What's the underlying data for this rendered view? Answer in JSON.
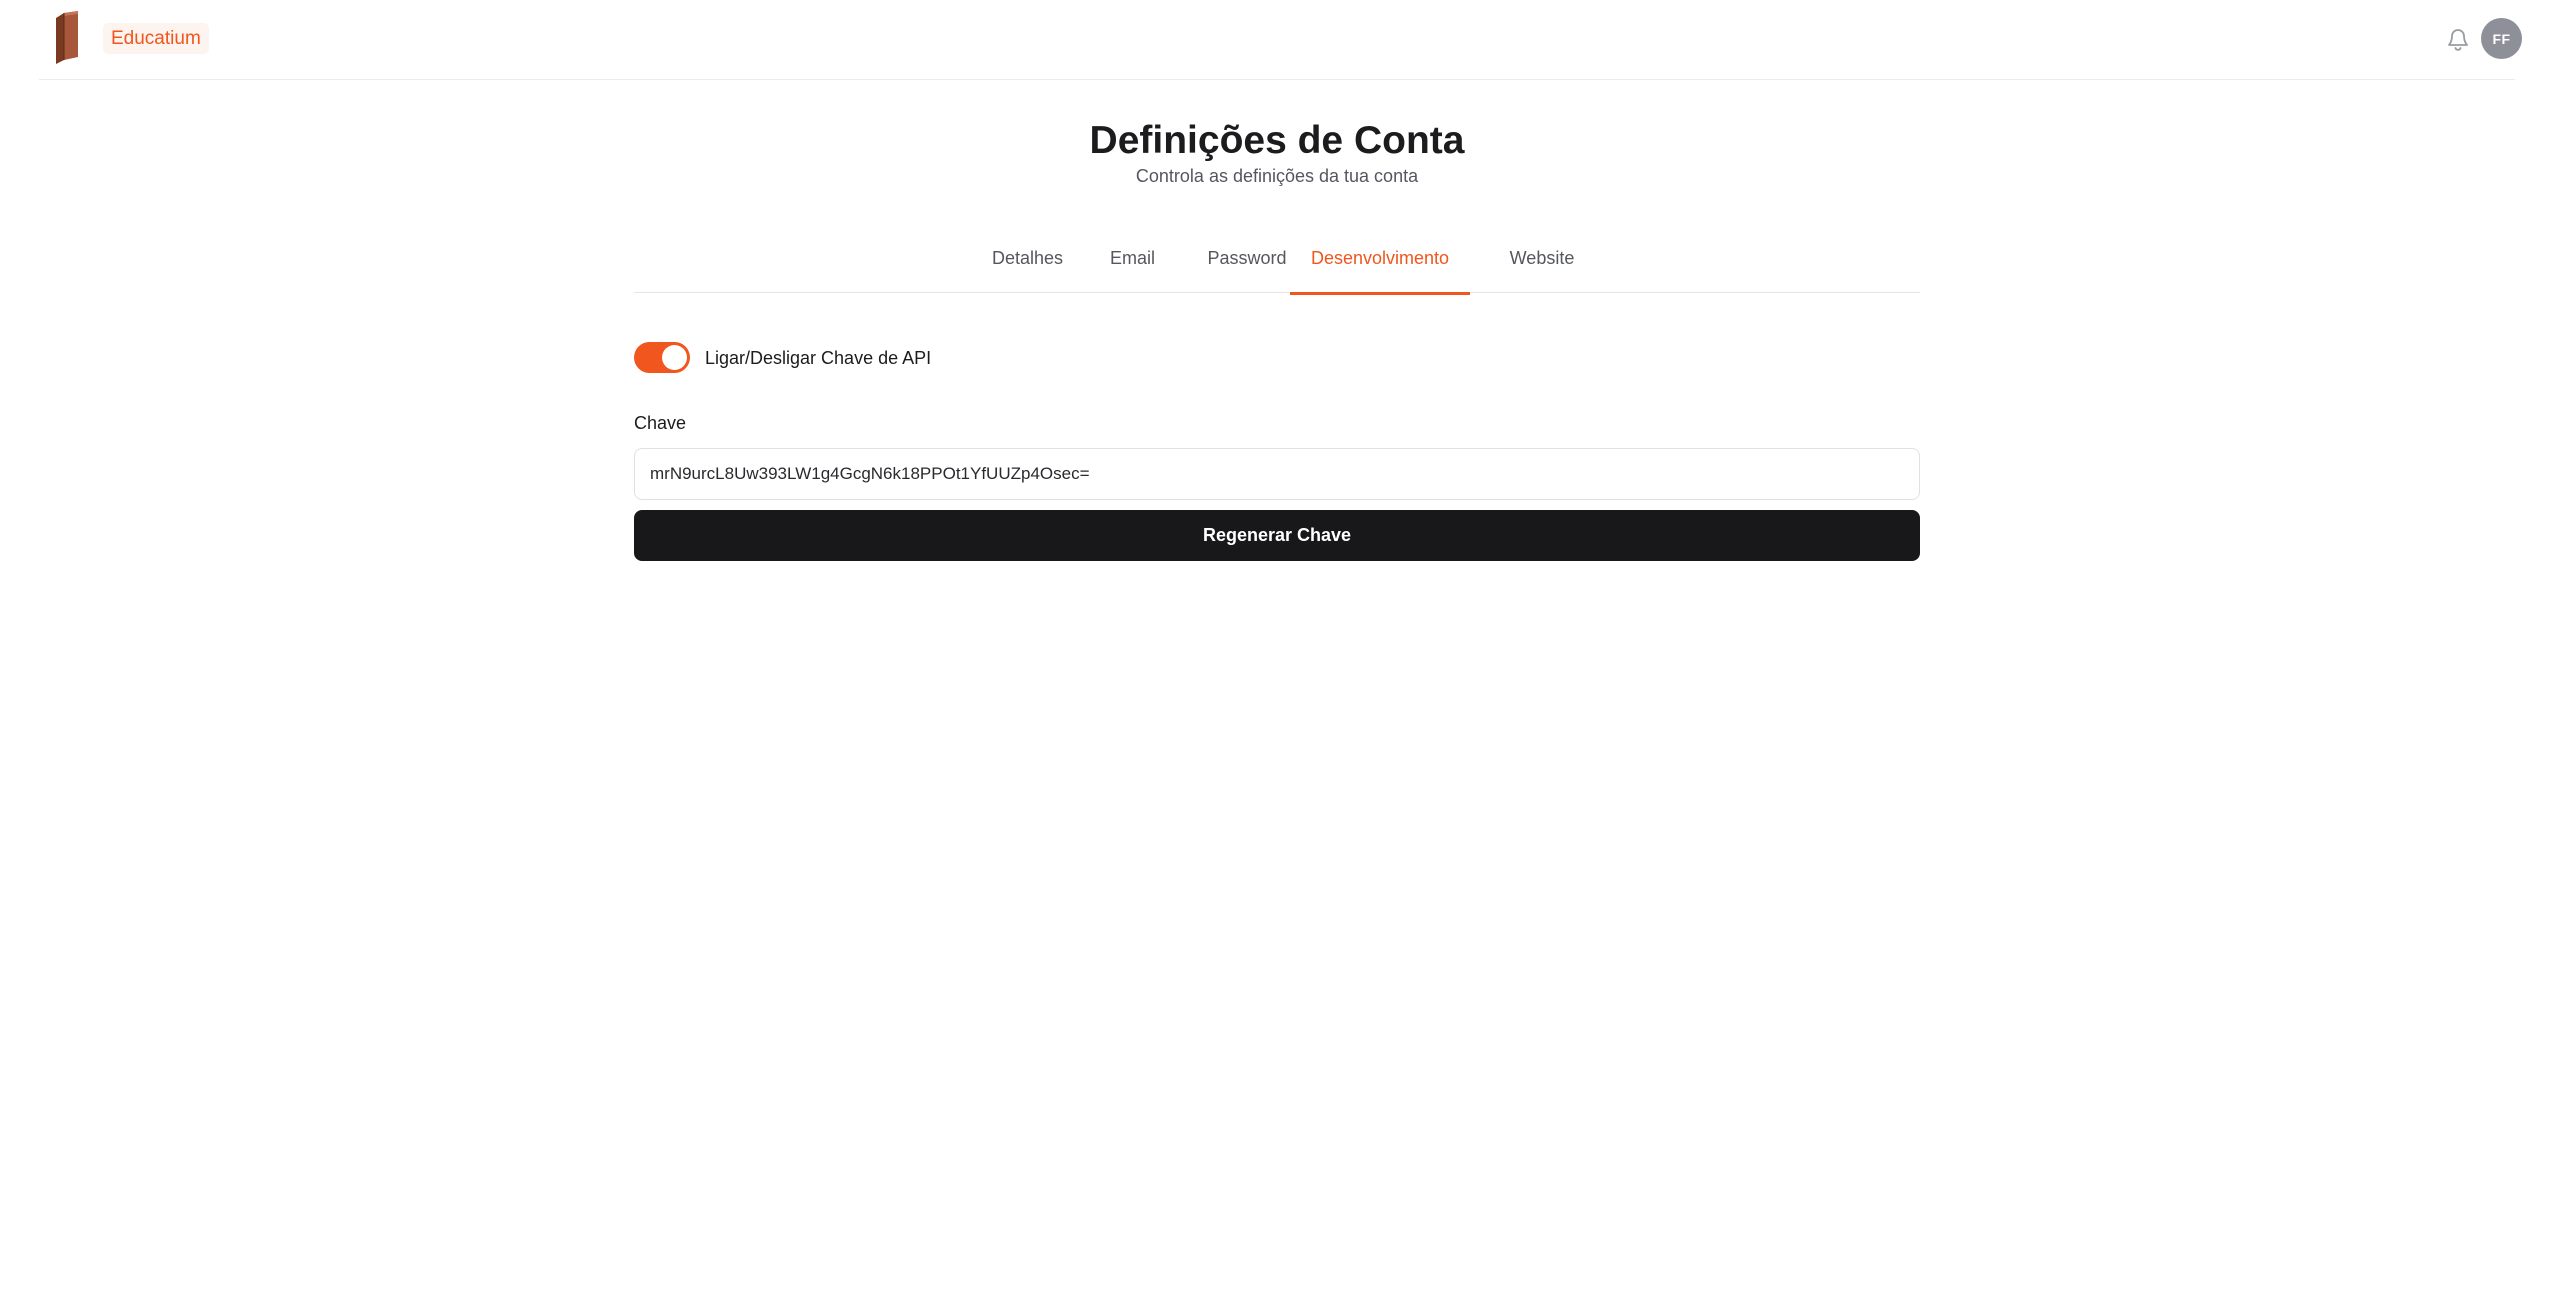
{
  "header": {
    "brand": "Educatium",
    "logo_icon": "book-icon",
    "notification_icon": "bell-icon",
    "avatar_initials": "FF"
  },
  "page": {
    "title": "Definições de Conta",
    "subtitle": "Controla as definições da tua conta"
  },
  "tabs": [
    {
      "label": "Detalhes",
      "active": false
    },
    {
      "label": "Email",
      "active": false
    },
    {
      "label": "Password",
      "active": false
    },
    {
      "label": "Desenvolvimento",
      "active": true
    },
    {
      "label": "Website",
      "active": false
    }
  ],
  "api_toggle": {
    "label": "Ligar/Desligar Chave de API",
    "enabled": true
  },
  "key_field": {
    "label": "Chave",
    "value": "mrN9urcL8Uw393LW1g4GcgN6k18PPOt1YfUUZp4Osec="
  },
  "regenerate_button": {
    "label": "Regenerar Chave"
  },
  "colors": {
    "accent": "#f0561d",
    "button_dark": "#18181b",
    "avatar_bg": "#8d8f99"
  }
}
